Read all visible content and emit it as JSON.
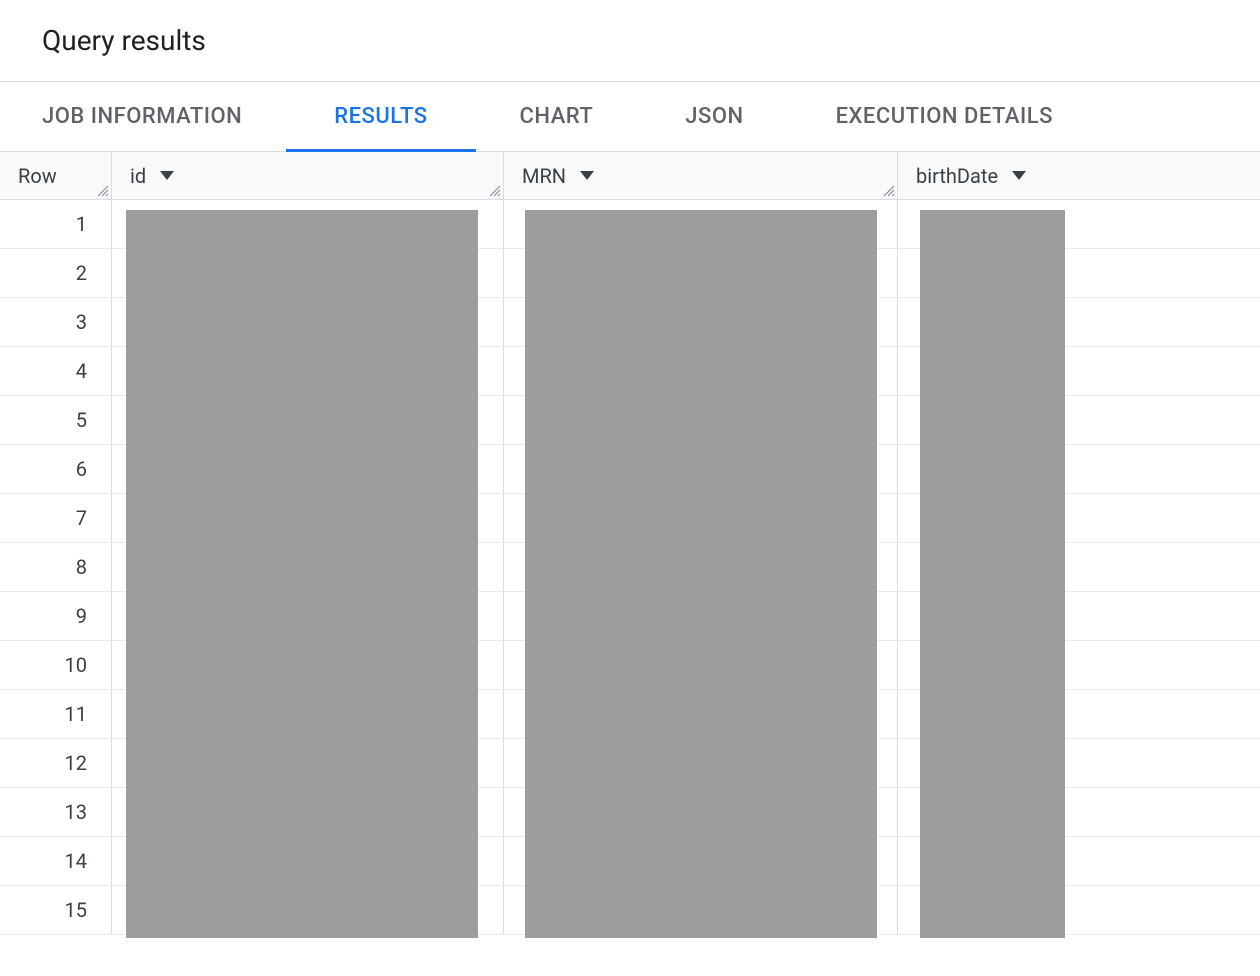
{
  "header": {
    "title": "Query results"
  },
  "tabs": [
    {
      "label": "JOB INFORMATION",
      "active": false
    },
    {
      "label": "RESULTS",
      "active": true
    },
    {
      "label": "CHART",
      "active": false
    },
    {
      "label": "JSON",
      "active": false
    },
    {
      "label": "EXECUTION DETAILS",
      "active": false
    }
  ],
  "columns": {
    "row": "Row",
    "id": "id",
    "mrn": "MRN",
    "birthdate": "birthDate"
  },
  "rows": [
    {
      "num": "1"
    },
    {
      "num": "2"
    },
    {
      "num": "3"
    },
    {
      "num": "4"
    },
    {
      "num": "5"
    },
    {
      "num": "6"
    },
    {
      "num": "7"
    },
    {
      "num": "8"
    },
    {
      "num": "9"
    },
    {
      "num": "10"
    },
    {
      "num": "11"
    },
    {
      "num": "12"
    },
    {
      "num": "13"
    },
    {
      "num": "14"
    },
    {
      "num": "15"
    }
  ]
}
